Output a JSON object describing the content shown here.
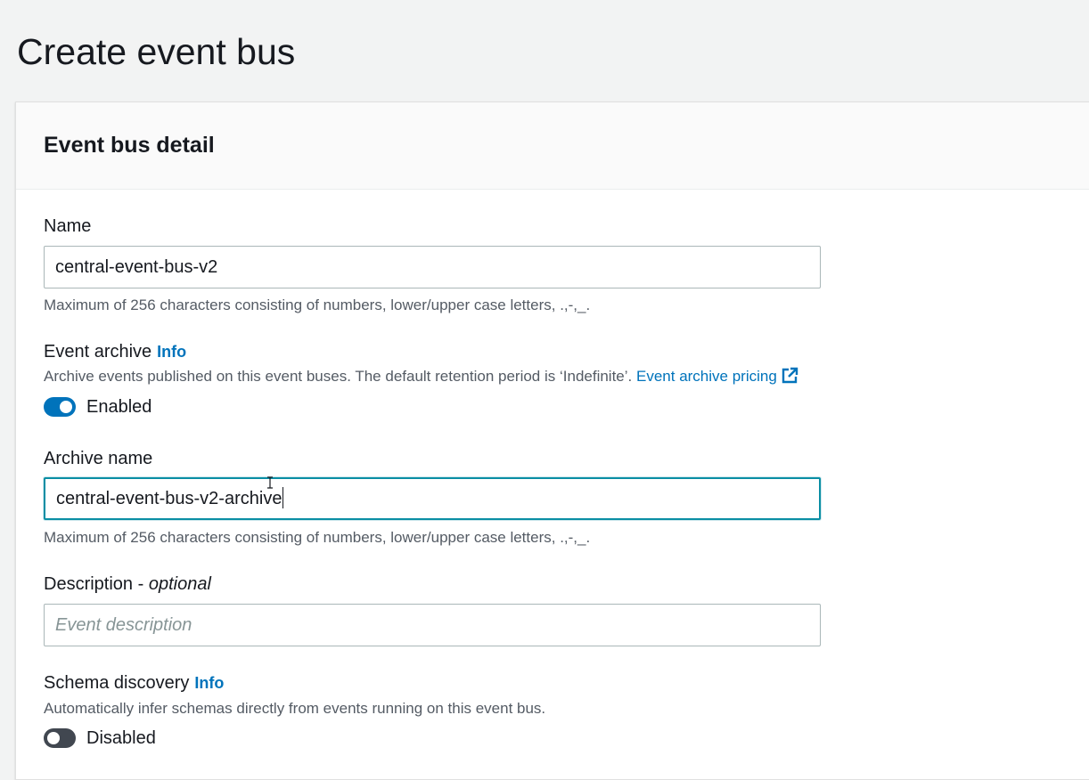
{
  "page": {
    "title": "Create event bus"
  },
  "panel": {
    "title": "Event bus detail"
  },
  "name_field": {
    "label": "Name",
    "value": "central-event-bus-v2",
    "constraint": "Maximum of 256 characters consisting of numbers, lower/upper case letters, .,-,_."
  },
  "event_archive": {
    "label": "Event archive",
    "info": "Info",
    "description": "Archive events published on this event buses. The default retention period is ‘Indefinite’.",
    "pricing_link": "Event archive pricing",
    "toggle_state": "on",
    "toggle_label": "Enabled"
  },
  "archive_name_field": {
    "label": "Archive name",
    "value": "central-event-bus-v2-archive",
    "constraint": "Maximum of 256 characters consisting of numbers, lower/upper case letters, .,-,_."
  },
  "description_field": {
    "label": "Description -",
    "optional": "optional",
    "placeholder": "Event description",
    "value": ""
  },
  "schema_discovery": {
    "label": "Schema discovery",
    "info": "Info",
    "description": "Automatically infer schemas directly from events running on this event bus.",
    "toggle_state": "off",
    "toggle_label": "Disabled"
  },
  "colors": {
    "link": "#0073bb",
    "focus_border": "#0a8ea4",
    "toggle_on": "#0073bb",
    "toggle_off": "#414750"
  }
}
